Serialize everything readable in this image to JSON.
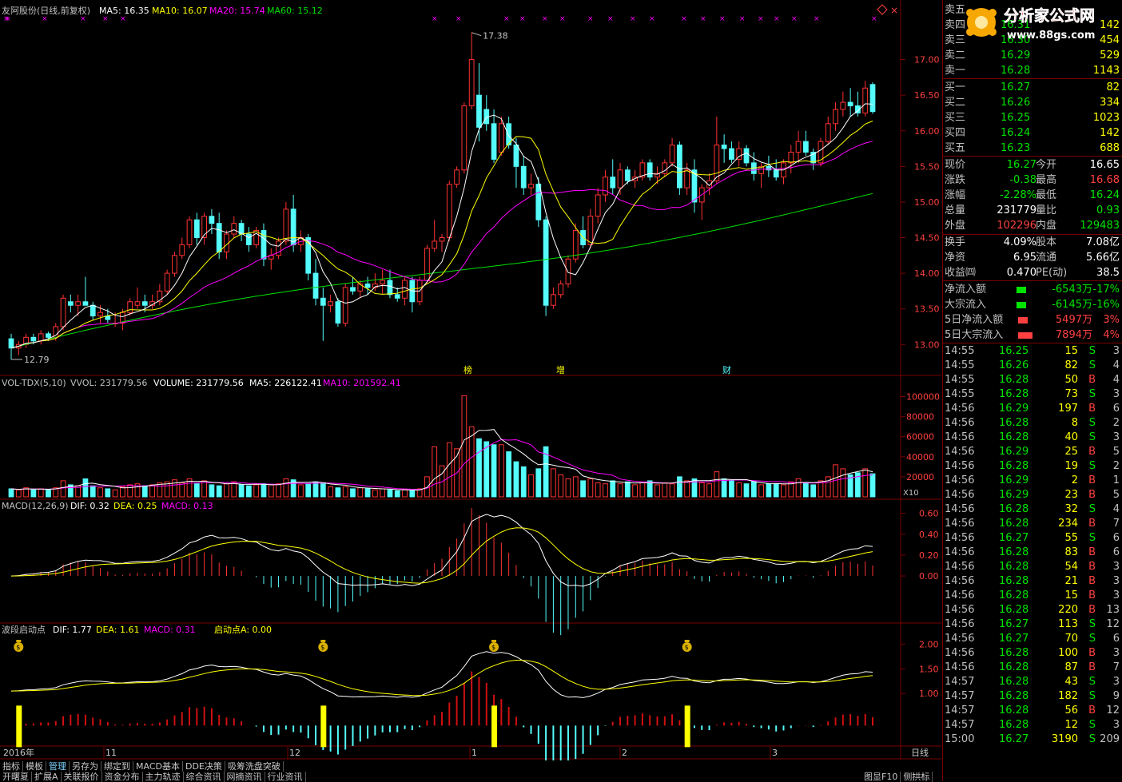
{
  "colors": {
    "up": "#ff3232",
    "down": "#54fcfc",
    "ma5": "#ffffff",
    "ma10": "#ffff00",
    "ma20": "#ff00ff",
    "ma60": "#00e000",
    "axis": "#7a0000",
    "red_text": "#ff4040",
    "green_text": "#00e400",
    "label_text": "#c0c0c0",
    "cyan": "#54fcfc"
  },
  "header": {
    "title": "友阿股份(日线,前复权)",
    "ma5": "MA5: 16.35",
    "ma10": "MA10: 16.07",
    "ma20": "MA20: 15.74",
    "ma60": "MA60: 15.12"
  },
  "price_axis": {
    "ticks": [
      "17.00",
      "16.50",
      "16.00",
      "15.50",
      "15.00",
      "14.50",
      "14.00",
      "13.50",
      "13.00"
    ]
  },
  "price_annotations": {
    "high": "17.38",
    "low": "12.79"
  },
  "event_markers": [
    "榜",
    "增",
    "财"
  ],
  "volume_panel": {
    "label_name": "VOL-TDX(5,10)",
    "vvol": "VVOL: 231779.56",
    "volume": "VOLUME: 231779.56",
    "ma5": "MA5: 226122.41",
    "ma10": "MA10: 201592.41",
    "ticks": [
      "100000",
      "80000",
      "60000",
      "40000",
      "20000"
    ],
    "unit": "X10"
  },
  "macd_panel": {
    "name": "MACD(12,26,9)",
    "dif": "DIF: 0.32",
    "dea": "DEA: 0.25",
    "macd": "MACD: 0.13",
    "ticks": [
      "0.60",
      "0.40",
      "0.20",
      "0.00"
    ]
  },
  "wave_panel": {
    "name": "波段启动点",
    "dif": "DIF: 1.77",
    "dea": "DEA: 1.61",
    "macd": "MACD: 0.31",
    "start": "启动点A: 0.00",
    "ticks": [
      "2.00",
      "1.50",
      "1.00"
    ]
  },
  "date_axis": [
    "2016年",
    "11",
    "12",
    "1",
    "2",
    "3"
  ],
  "period_label": "日线",
  "tabs_row1": [
    "指标",
    "模板",
    "管理",
    "另存为",
    "绑定到",
    "MACD基本",
    "DDE决策",
    "吸筹洗盘突破"
  ],
  "tabs_row2": [
    "开曙夏",
    "扩展A",
    "关联报价",
    "资金分布",
    "主力轨迹",
    "综合资讯",
    "网摘资讯",
    "行业资讯"
  ],
  "tabs_right": [
    "图显F10",
    "侧拱标"
  ],
  "watermark": {
    "title": "分析家公式网",
    "url": "www.88gs.com"
  },
  "order_book": {
    "sell": [
      {
        "label": "卖五",
        "price": "",
        "vol": ""
      },
      {
        "label": "卖四",
        "price": "16.31",
        "vol": "142"
      },
      {
        "label": "卖三",
        "price": "16.30",
        "vol": "454"
      },
      {
        "label": "卖二",
        "price": "16.29",
        "vol": "529"
      },
      {
        "label": "卖一",
        "price": "16.28",
        "vol": "1143"
      }
    ],
    "buy": [
      {
        "label": "买一",
        "price": "16.27",
        "vol": "82"
      },
      {
        "label": "买二",
        "price": "16.26",
        "vol": "334"
      },
      {
        "label": "买三",
        "price": "16.25",
        "vol": "1023"
      },
      {
        "label": "买四",
        "price": "16.24",
        "vol": "142"
      },
      {
        "label": "买五",
        "price": "16.23",
        "vol": "688"
      }
    ]
  },
  "stats": [
    {
      "l1": "现价",
      "v1": "16.27",
      "l2": "今开",
      "v2": "16.65",
      "c1": "green",
      "c2": "white"
    },
    {
      "l1": "涨跌",
      "v1": "-0.38",
      "l2": "最高",
      "v2": "16.68",
      "c1": "green",
      "c2": "red"
    },
    {
      "l1": "涨幅",
      "v1": "-2.28%",
      "l2": "最低",
      "v2": "16.24",
      "c1": "green",
      "c2": "green"
    },
    {
      "l1": "总量",
      "v1": "231779",
      "l2": "量比",
      "v2": "0.93",
      "c1": "white",
      "c2": "green"
    },
    {
      "l1": "外盘",
      "v1": "102296",
      "l2": "内盘",
      "v2": "129483",
      "c1": "red",
      "c2": "green"
    },
    {
      "l1": "换手",
      "v1": "4.09%",
      "l2": "股本",
      "v2": "7.08亿",
      "c1": "white",
      "c2": "white"
    },
    {
      "l1": "净资",
      "v1": "6.95",
      "l2": "流通",
      "v2": "5.66亿",
      "c1": "white",
      "c2": "white"
    },
    {
      "l1": "收益㈣",
      "v1": "0.470",
      "l2": "PE(动)",
      "v2": "38.5",
      "c1": "white",
      "c2": "white"
    }
  ],
  "flows": [
    {
      "label": "净流入额",
      "value": "-6543万",
      "pct": "-17%",
      "color": "green",
      "bar": 0.6
    },
    {
      "label": "大宗流入",
      "value": "-6145万",
      "pct": "-16%",
      "color": "green",
      "bar": 0.6
    },
    {
      "label": "5日净流入额",
      "value": "5497万",
      "pct": "3%",
      "color": "red",
      "bar": 0.6
    },
    {
      "label": "5日大宗流入",
      "value": "7894万",
      "pct": "4%",
      "color": "red",
      "bar": 0.9
    }
  ],
  "ticks": [
    {
      "t": "14:55",
      "p": "16.25",
      "v": "15",
      "s": "S",
      "n": "3"
    },
    {
      "t": "14:55",
      "p": "16.26",
      "v": "82",
      "s": "S",
      "n": "4"
    },
    {
      "t": "14:55",
      "p": "16.28",
      "v": "50",
      "s": "B",
      "n": "4"
    },
    {
      "t": "14:55",
      "p": "16.28",
      "v": "73",
      "s": "S",
      "n": "3"
    },
    {
      "t": "14:56",
      "p": "16.29",
      "v": "197",
      "s": "B",
      "n": "6"
    },
    {
      "t": "14:56",
      "p": "16.28",
      "v": "8",
      "s": "S",
      "n": "2"
    },
    {
      "t": "14:56",
      "p": "16.28",
      "v": "40",
      "s": "S",
      "n": "3"
    },
    {
      "t": "14:56",
      "p": "16.29",
      "v": "25",
      "s": "B",
      "n": "5"
    },
    {
      "t": "14:56",
      "p": "16.28",
      "v": "19",
      "s": "S",
      "n": "2"
    },
    {
      "t": "14:56",
      "p": "16.29",
      "v": "2",
      "s": "B",
      "n": "1"
    },
    {
      "t": "14:56",
      "p": "16.29",
      "v": "23",
      "s": "B",
      "n": "5"
    },
    {
      "t": "14:56",
      "p": "16.28",
      "v": "32",
      "s": "S",
      "n": "4"
    },
    {
      "t": "14:56",
      "p": "16.28",
      "v": "234",
      "s": "B",
      "n": "7"
    },
    {
      "t": "14:56",
      "p": "16.27",
      "v": "55",
      "s": "S",
      "n": "6"
    },
    {
      "t": "14:56",
      "p": "16.28",
      "v": "83",
      "s": "B",
      "n": "6"
    },
    {
      "t": "14:56",
      "p": "16.28",
      "v": "54",
      "s": "B",
      "n": "3"
    },
    {
      "t": "14:56",
      "p": "16.28",
      "v": "21",
      "s": "B",
      "n": "3"
    },
    {
      "t": "14:56",
      "p": "16.28",
      "v": "15",
      "s": "B",
      "n": "3"
    },
    {
      "t": "14:56",
      "p": "16.28",
      "v": "220",
      "s": "B",
      "n": "13"
    },
    {
      "t": "14:56",
      "p": "16.27",
      "v": "113",
      "s": "S",
      "n": "12"
    },
    {
      "t": "14:56",
      "p": "16.27",
      "v": "70",
      "s": "S",
      "n": "6"
    },
    {
      "t": "14:56",
      "p": "16.28",
      "v": "100",
      "s": "B",
      "n": "3"
    },
    {
      "t": "14:56",
      "p": "16.28",
      "v": "87",
      "s": "B",
      "n": "7"
    },
    {
      "t": "14:57",
      "p": "16.28",
      "v": "43",
      "s": "S",
      "n": "3"
    },
    {
      "t": "14:57",
      "p": "16.28",
      "v": "182",
      "s": "S",
      "n": "9"
    },
    {
      "t": "14:57",
      "p": "16.28",
      "v": "56",
      "s": "B",
      "n": "12"
    },
    {
      "t": "14:57",
      "p": "16.28",
      "v": "12",
      "s": "S",
      "n": "3"
    },
    {
      "t": "15:00",
      "p": "16.27",
      "v": "3190",
      "s": "S",
      "n": "209"
    }
  ],
  "chart_data": {
    "type": "candlestick",
    "dates_approx": "2016-10 .. 2017-03",
    "ohlc": [
      [
        13.08,
        13.15,
        12.79,
        12.95
      ],
      [
        12.95,
        13.05,
        12.85,
        13.0
      ],
      [
        13.0,
        13.15,
        12.95,
        13.1
      ],
      [
        13.1,
        13.15,
        13.0,
        13.05
      ],
      [
        13.05,
        13.2,
        13.0,
        13.15
      ],
      [
        13.15,
        13.18,
        13.05,
        13.1
      ],
      [
        13.1,
        13.3,
        13.05,
        13.25
      ],
      [
        13.25,
        13.7,
        13.2,
        13.65
      ],
      [
        13.6,
        13.7,
        13.45,
        13.55
      ],
      [
        13.55,
        13.7,
        13.4,
        13.6
      ],
      [
        13.6,
        13.95,
        13.55,
        13.55
      ],
      [
        13.55,
        13.6,
        13.35,
        13.4
      ],
      [
        13.4,
        13.55,
        13.3,
        13.45
      ],
      [
        13.4,
        13.5,
        13.3,
        13.35
      ],
      [
        13.3,
        13.45,
        13.25,
        13.3
      ],
      [
        13.3,
        13.5,
        13.2,
        13.45
      ],
      [
        13.45,
        13.65,
        13.4,
        13.6
      ],
      [
        13.55,
        13.8,
        13.5,
        13.6
      ],
      [
        13.6,
        13.7,
        13.45,
        13.55
      ],
      [
        13.55,
        13.7,
        13.5,
        13.6
      ],
      [
        13.6,
        13.85,
        13.55,
        13.75
      ],
      [
        13.75,
        14.05,
        13.7,
        14.0
      ],
      [
        14.0,
        14.3,
        13.95,
        14.25
      ],
      [
        14.25,
        14.5,
        14.2,
        14.4
      ],
      [
        14.4,
        14.8,
        14.35,
        14.75
      ],
      [
        14.75,
        14.85,
        14.4,
        14.5
      ],
      [
        14.5,
        14.85,
        14.4,
        14.8
      ],
      [
        14.8,
        14.9,
        14.55,
        14.7
      ],
      [
        14.7,
        14.85,
        14.2,
        14.3
      ],
      [
        14.3,
        14.6,
        14.2,
        14.55
      ],
      [
        14.55,
        14.8,
        14.5,
        14.7
      ],
      [
        14.7,
        14.75,
        14.45,
        14.55
      ],
      [
        14.55,
        14.65,
        14.3,
        14.4
      ],
      [
        14.4,
        14.65,
        14.35,
        14.6
      ],
      [
        14.6,
        14.7,
        14.1,
        14.2
      ],
      [
        14.2,
        14.35,
        14.05,
        14.25
      ],
      [
        14.25,
        14.5,
        14.2,
        14.45
      ],
      [
        14.45,
        15.0,
        14.4,
        14.9
      ],
      [
        14.9,
        15.1,
        14.3,
        14.4
      ],
      [
        14.4,
        14.6,
        14.3,
        14.5
      ],
      [
        14.5,
        14.55,
        13.9,
        14.0
      ],
      [
        14.0,
        14.2,
        13.55,
        13.65
      ],
      [
        13.65,
        13.8,
        13.05,
        13.55
      ],
      [
        13.55,
        13.7,
        13.45,
        13.6
      ],
      [
        13.6,
        13.65,
        13.25,
        13.3
      ],
      [
        13.3,
        13.85,
        13.25,
        13.8
      ],
      [
        13.8,
        13.95,
        13.7,
        13.75
      ],
      [
        13.75,
        13.9,
        13.65,
        13.85
      ],
      [
        13.85,
        13.95,
        13.7,
        13.8
      ],
      [
        13.8,
        14.0,
        13.75,
        13.85
      ],
      [
        13.85,
        14.05,
        13.7,
        13.9
      ],
      [
        13.9,
        14.05,
        13.65,
        13.7
      ],
      [
        13.7,
        13.8,
        13.6,
        13.65
      ],
      [
        13.65,
        13.95,
        13.55,
        13.9
      ],
      [
        13.9,
        13.95,
        13.45,
        13.6
      ],
      [
        13.6,
        13.95,
        13.55,
        13.9
      ],
      [
        13.9,
        14.4,
        13.85,
        14.35
      ],
      [
        14.35,
        14.75,
        14.3,
        14.45
      ],
      [
        14.45,
        14.55,
        14.3,
        14.5
      ],
      [
        14.5,
        15.3,
        14.45,
        15.25
      ],
      [
        15.25,
        15.5,
        15.2,
        15.45
      ],
      [
        15.45,
        16.4,
        15.4,
        16.35
      ],
      [
        16.35,
        17.38,
        16.3,
        17.0
      ],
      [
        16.5,
        16.95,
        15.85,
        16.05
      ],
      [
        16.3,
        16.5,
        16.0,
        16.1
      ],
      [
        16.1,
        16.3,
        15.55,
        15.6
      ],
      [
        15.7,
        16.2,
        15.65,
        16.1
      ],
      [
        16.1,
        16.2,
        15.75,
        15.8
      ],
      [
        15.8,
        15.9,
        15.2,
        15.5
      ],
      [
        15.5,
        15.65,
        15.1,
        15.2
      ],
      [
        15.2,
        15.4,
        15.1,
        15.25
      ],
      [
        15.25,
        15.35,
        14.65,
        14.75
      ],
      [
        14.75,
        14.8,
        13.4,
        13.55
      ],
      [
        13.55,
        13.8,
        13.5,
        13.7
      ],
      [
        13.7,
        13.9,
        13.65,
        13.85
      ],
      [
        13.85,
        14.25,
        13.8,
        14.2
      ],
      [
        14.2,
        14.7,
        14.15,
        14.6
      ],
      [
        14.6,
        14.8,
        14.35,
        14.4
      ],
      [
        14.4,
        14.9,
        14.35,
        14.8
      ],
      [
        14.8,
        15.2,
        14.7,
        15.1
      ],
      [
        15.1,
        15.45,
        15.0,
        15.35
      ],
      [
        15.35,
        15.6,
        15.1,
        15.2
      ],
      [
        15.2,
        15.55,
        15.1,
        15.45
      ],
      [
        15.45,
        15.5,
        15.25,
        15.3
      ],
      [
        15.3,
        15.45,
        15.2,
        15.35
      ],
      [
        15.35,
        15.6,
        15.3,
        15.55
      ],
      [
        15.55,
        15.6,
        15.3,
        15.35
      ],
      [
        15.35,
        15.5,
        15.25,
        15.4
      ],
      [
        15.4,
        15.6,
        15.35,
        15.55
      ],
      [
        15.55,
        15.9,
        15.5,
        15.8
      ],
      [
        15.8,
        15.85,
        15.1,
        15.2
      ],
      [
        15.2,
        15.55,
        15.1,
        15.45
      ],
      [
        15.45,
        15.6,
        14.85,
        15.0
      ],
      [
        15.0,
        15.25,
        14.75,
        15.2
      ],
      [
        15.2,
        15.4,
        15.1,
        15.3
      ],
      [
        15.3,
        16.2,
        15.25,
        15.8
      ],
      [
        15.8,
        15.95,
        15.55,
        15.75
      ],
      [
        15.75,
        15.85,
        15.55,
        15.6
      ],
      [
        15.6,
        15.85,
        15.5,
        15.75
      ],
      [
        15.75,
        15.8,
        15.5,
        15.55
      ],
      [
        15.55,
        15.7,
        15.3,
        15.4
      ],
      [
        15.4,
        15.55,
        15.2,
        15.5
      ],
      [
        15.5,
        15.65,
        15.35,
        15.45
      ],
      [
        15.45,
        15.6,
        15.3,
        15.35
      ],
      [
        15.35,
        15.6,
        15.25,
        15.55
      ],
      [
        15.55,
        15.8,
        15.4,
        15.7
      ],
      [
        15.7,
        16.0,
        15.55,
        15.85
      ],
      [
        15.85,
        16.0,
        15.65,
        15.7
      ],
      [
        15.7,
        15.75,
        15.45,
        15.55
      ],
      [
        15.55,
        15.9,
        15.5,
        15.85
      ],
      [
        15.85,
        16.2,
        15.8,
        16.1
      ],
      [
        16.1,
        16.4,
        16.0,
        16.3
      ],
      [
        16.3,
        16.55,
        16.2,
        16.4
      ],
      [
        16.4,
        16.6,
        16.2,
        16.35
      ],
      [
        16.35,
        16.55,
        16.2,
        16.25
      ],
      [
        16.25,
        16.7,
        16.2,
        16.6
      ],
      [
        16.65,
        16.68,
        16.24,
        16.27
      ]
    ],
    "ylim": [
      12.7,
      17.5
    ],
    "volume_ylim": [
      0,
      110000
    ],
    "macd_ylim": [
      -0.42,
      0.62
    ],
    "wave_ylim": [
      0.0,
      2.2
    ]
  }
}
